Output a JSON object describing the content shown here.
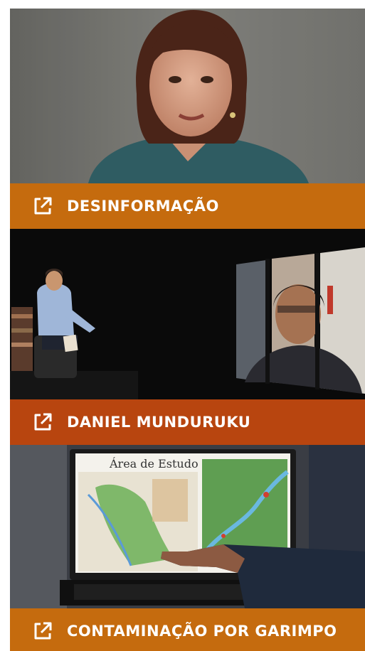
{
  "cards": [
    {
      "title": "DESINFORMAÇÃO",
      "icon": "external-link-icon",
      "bar_color": "#c56b0e"
    },
    {
      "title": "DANIEL MUNDURUKU",
      "icon": "external-link-icon",
      "bar_color": "#b8450f"
    },
    {
      "title": "CONTAMINAÇÃO POR  GARIMPO",
      "icon": "external-link-icon",
      "bar_color": "#c56b0e"
    }
  ],
  "map_screen": {
    "title": "Área de Estudo"
  }
}
